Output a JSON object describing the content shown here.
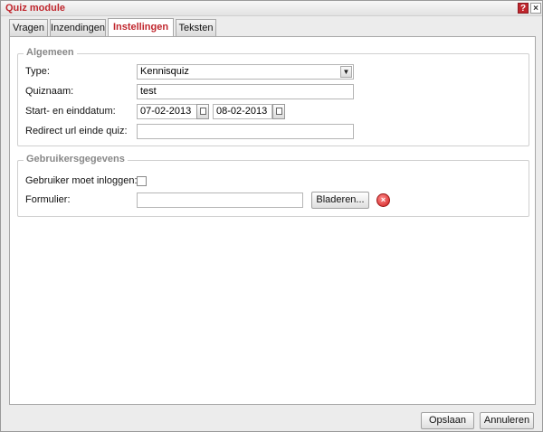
{
  "window": {
    "title": "Quiz module",
    "help_icon": "?",
    "close_icon": "×"
  },
  "tabs": [
    {
      "label": "Vragen"
    },
    {
      "label": "Inzendingen"
    },
    {
      "label": "Instellingen",
      "active": true
    },
    {
      "label": "Teksten"
    }
  ],
  "algemeen": {
    "legend": "Algemeen",
    "type_label": "Type:",
    "type_value": "Kennisquiz",
    "quiznaam_label": "Quiznaam:",
    "quiznaam_value": "test",
    "datum_label": "Start- en einddatum:",
    "start_date": "07-02-2013",
    "end_date": "08-02-2013",
    "redirect_label": "Redirect url einde quiz:",
    "redirect_value": ""
  },
  "gebruikers": {
    "legend": "Gebruikersgegevens",
    "login_label": "Gebruiker moet inloggen:",
    "login_checked": false,
    "formulier_label": "Formulier:",
    "formulier_value": "",
    "browse_label": "Bladeren...",
    "delete_icon": "×"
  },
  "footer": {
    "save_label": "Opslaan",
    "cancel_label": "Annuleren"
  },
  "colors": {
    "accent": "#c0262d"
  }
}
